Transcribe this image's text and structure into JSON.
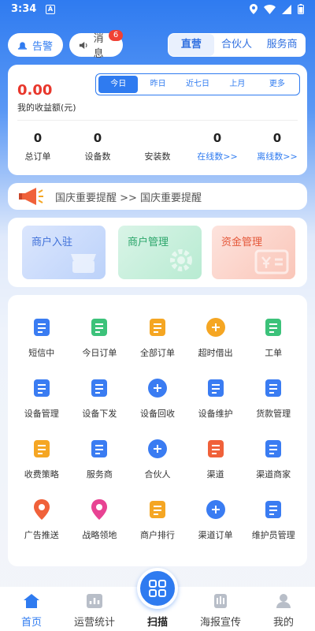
{
  "status_bar": {
    "time": "3:34",
    "alert_glyph": "A"
  },
  "top": {
    "warn_label": "告警",
    "msg_label": "消息",
    "msg_badge": "6"
  },
  "role_tabs": [
    "直营",
    "合伙人",
    "服务商"
  ],
  "income": {
    "amount": "0.00",
    "amount_label": "我的收益额(元)",
    "ranges": [
      "今日",
      "昨日",
      "近七日",
      "上月",
      "更多"
    ],
    "stats": [
      {
        "value": "0",
        "label": "总订单"
      },
      {
        "value": "0",
        "label": "设备数"
      },
      {
        "value": "",
        "label": "安装数"
      },
      {
        "value": "0",
        "label": "在线数>>"
      },
      {
        "value": "0",
        "label": "离线数>>"
      }
    ]
  },
  "notice": {
    "text": "国庆重要提醒 >> 国庆重要提醒"
  },
  "quick": [
    "商户入驻",
    "商户管理",
    "资金管理"
  ],
  "grid": [
    {
      "label": "短信中",
      "icon": "message-icon",
      "color": "#3a7cf2"
    },
    {
      "label": "今日订单",
      "icon": "calendar-icon",
      "color": "#3cc27a"
    },
    {
      "label": "全部订单",
      "icon": "orders-icon",
      "color": "#f5a623"
    },
    {
      "label": "超时借出",
      "icon": "alarm-icon",
      "color": "#f5a623"
    },
    {
      "label": "工单",
      "icon": "workorder-icon",
      "color": "#3cc27a"
    },
    {
      "label": "设备管理",
      "icon": "clipboard-icon",
      "color": "#3a7cf2"
    },
    {
      "label": "设备下发",
      "icon": "device-icon",
      "color": "#3a7cf2"
    },
    {
      "label": "设备回收",
      "icon": "recycle-icon",
      "color": "#3a7cf2"
    },
    {
      "label": "设备维护",
      "icon": "maintenance-icon",
      "color": "#3a7cf2"
    },
    {
      "label": "货款管理",
      "icon": "wallet-icon",
      "color": "#3a7cf2"
    },
    {
      "label": "收费策略",
      "icon": "pricing-icon",
      "color": "#f5a623"
    },
    {
      "label": "服务商",
      "icon": "building-icon",
      "color": "#3a7cf2"
    },
    {
      "label": "合伙人",
      "icon": "partner-icon",
      "color": "#3a7cf2"
    },
    {
      "label": "渠道",
      "icon": "channel-icon",
      "color": "#f0613a"
    },
    {
      "label": "渠道商家",
      "icon": "merchant-icon",
      "color": "#3a7cf2"
    },
    {
      "label": "广告推送",
      "icon": "microphone-icon",
      "color": "#f0613a"
    },
    {
      "label": "战略领地",
      "icon": "location-icon",
      "color": "#e84393"
    },
    {
      "label": "商户排行",
      "icon": "ranking-icon",
      "color": "#f5a623"
    },
    {
      "label": "渠道订单",
      "icon": "network-icon",
      "color": "#3a7cf2"
    },
    {
      "label": "维护员管理",
      "icon": "staff-icon",
      "color": "#3a7cf2"
    }
  ],
  "bottom_nav": [
    {
      "label": "首页",
      "icon": "home-icon"
    },
    {
      "label": "运营统计",
      "icon": "chart-icon"
    },
    {
      "label": "扫描",
      "icon": "scan-icon"
    },
    {
      "label": "海报宣传",
      "icon": "poster-icon"
    },
    {
      "label": "我的",
      "icon": "user-icon"
    }
  ]
}
